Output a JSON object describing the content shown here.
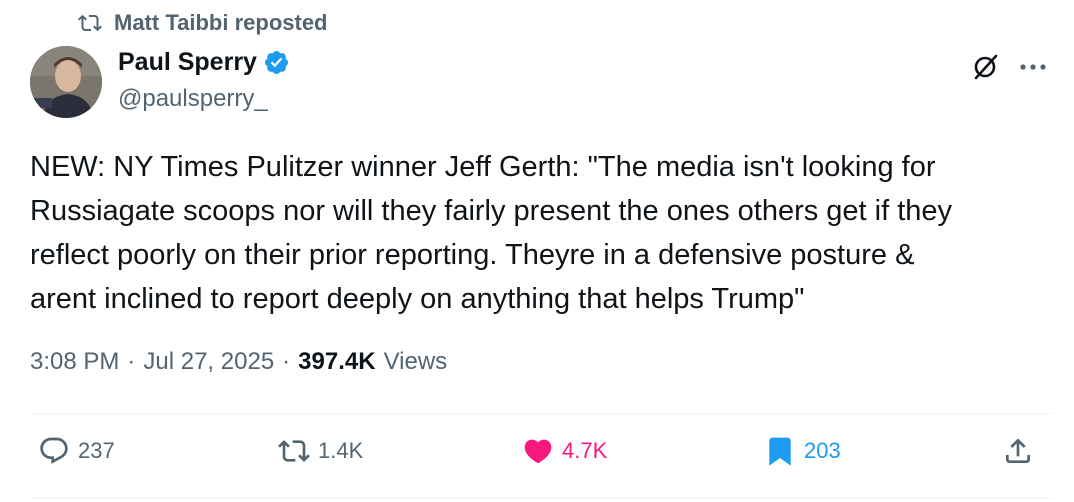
{
  "repost": {
    "text": "Matt Taibbi reposted",
    "icon": "repost-icon"
  },
  "author": {
    "display_name": "Paul Sperry",
    "handle": "@paulsperry_",
    "verified": true,
    "verified_color": "#1d9bf0"
  },
  "tweet": {
    "text": "NEW: NY Times Pulitzer winner Jeff Gerth: \"The media isn't looking for\nRussiagate scoops nor will they fairly present the ones others get if they\nreflect poorly on their prior reporting. Theyre in a defensive posture &\narent inclined to report deeply on anything that helps Trump\""
  },
  "meta": {
    "time": "3:08 PM",
    "separator": "·",
    "date": "Jul 27, 2025",
    "views_count": "397.4K",
    "views_label": "Views"
  },
  "actions": {
    "replies": "237",
    "reposts": "1.4K",
    "likes": "4.7K",
    "bookmarks": "203"
  },
  "colors": {
    "text_primary": "#0f1419",
    "text_secondary": "#536471",
    "like_pink": "#f91880",
    "accent_blue": "#1d9bf0"
  }
}
